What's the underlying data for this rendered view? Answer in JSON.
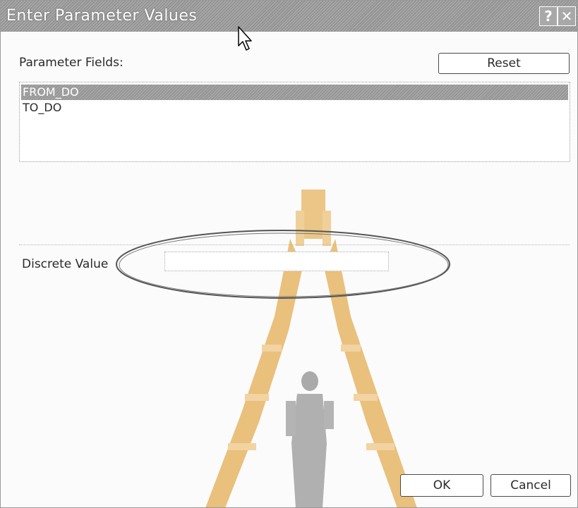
{
  "window": {
    "title": "Enter Parameter Values",
    "help_glyph": "?",
    "close_glyph": "✕"
  },
  "labels": {
    "parameter_fields": "Parameter Fields:",
    "discrete_value": "Discrete Value"
  },
  "buttons": {
    "reset": "Reset",
    "ok": "OK",
    "cancel": "Cancel"
  },
  "parameter_list": {
    "items": [
      {
        "label": "FROM_DO",
        "selected": true
      },
      {
        "label": "TO_DO",
        "selected": false
      }
    ]
  },
  "discrete_input": {
    "value": "",
    "placeholder": ""
  },
  "colors": {
    "titlebar": "#9c9c9c",
    "selection": "#9e9e9e",
    "highlight_ellipse": "#555555",
    "watermark_gold": "#e7b86a",
    "watermark_figure": "#9a9a9a"
  },
  "icons": {
    "help": "help-icon",
    "close": "close-icon",
    "cursor": "mouse-pointer-icon",
    "watermark": "university-emblem-watermark"
  }
}
